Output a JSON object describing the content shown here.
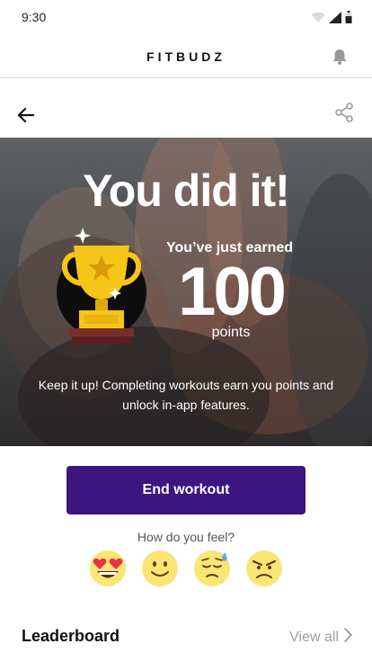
{
  "status_bar": {
    "time": "9:30"
  },
  "header": {
    "brand": "FITBUDZ"
  },
  "hero": {
    "title": "You did it!",
    "earned_text": "You’ve just earned",
    "points": "100",
    "points_label": "points",
    "message": "Keep it up! Completing workouts earn you points and unlock in-app features."
  },
  "actions": {
    "end_workout_label": "End workout"
  },
  "feeling": {
    "question": "How do you feel?",
    "moods": [
      "heart-eyes",
      "smile",
      "tired-sweat",
      "angry"
    ]
  },
  "leaderboard": {
    "title": "Leaderboard",
    "view_all": "View all"
  },
  "colors": {
    "primary": "#3d1580",
    "trophy_gold": "#f5c518",
    "mood_yellow": "#fbe574"
  }
}
